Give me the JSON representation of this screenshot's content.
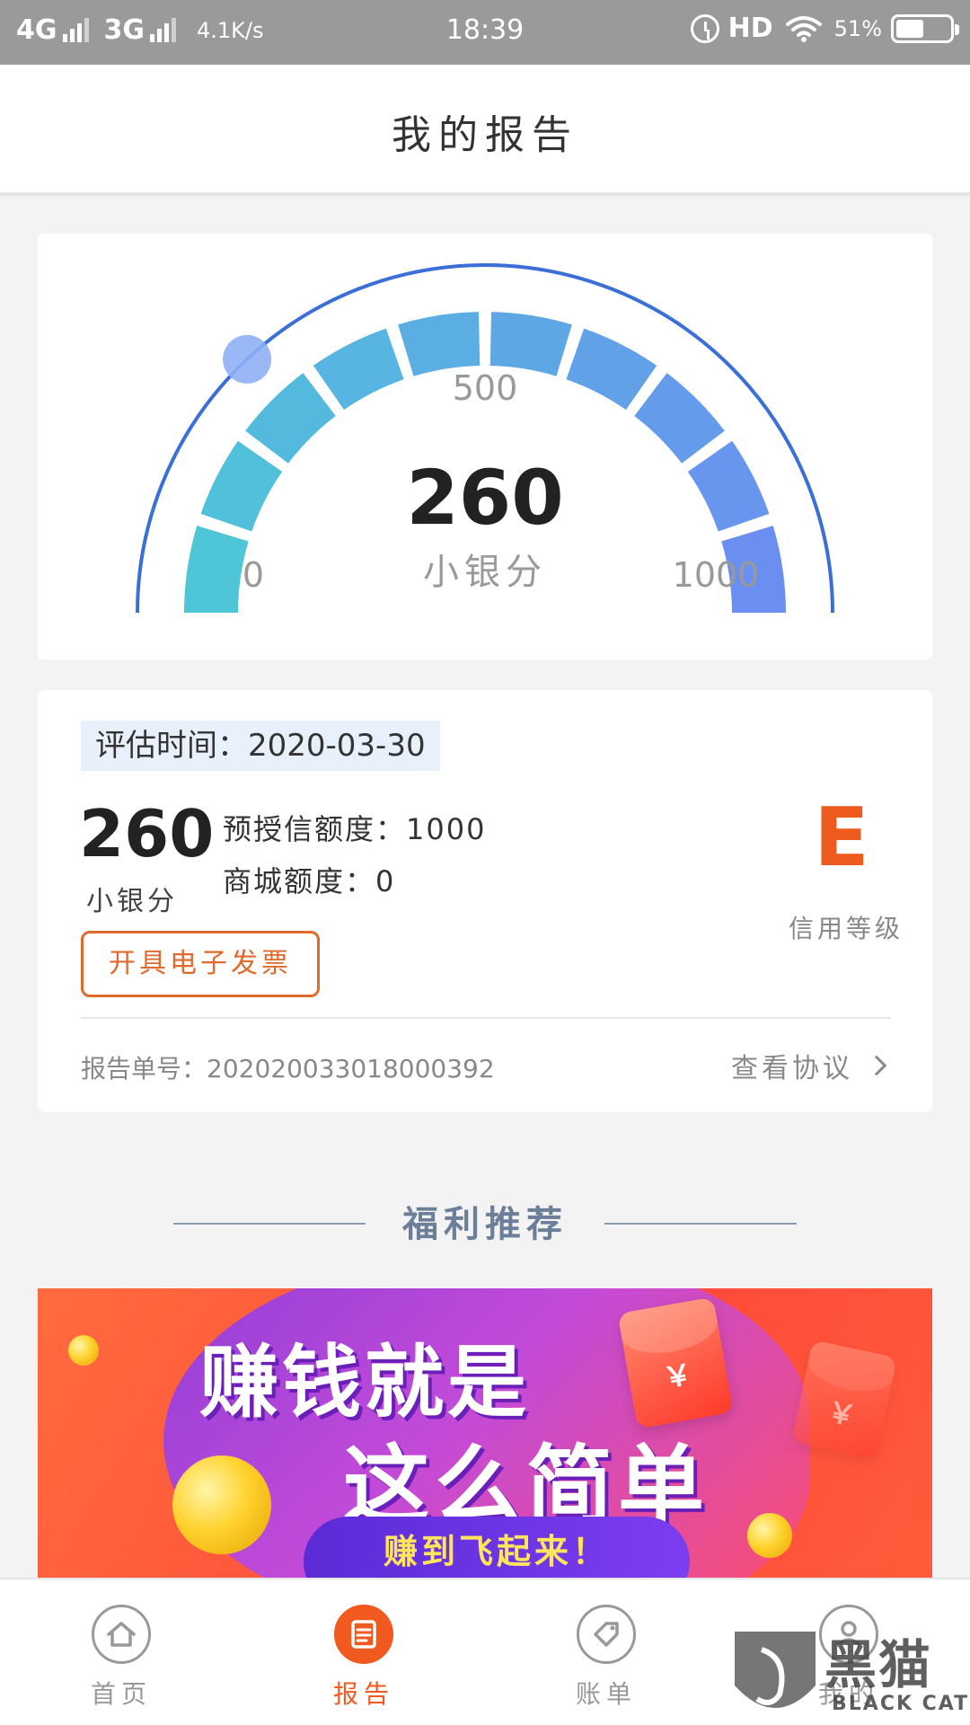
{
  "status_bar": {
    "net1": "4G",
    "net2": "3G",
    "speed": "4.1K/s",
    "time": "18:39",
    "hd": "HD",
    "battery_pct": "51%",
    "battery_level": 0.51
  },
  "header": {
    "title": "我的报告"
  },
  "gauge": {
    "score": "260",
    "score_label": "小银分",
    "scale_mid": "500",
    "scale_min": "0",
    "scale_max": "1000",
    "value": 260,
    "min": 0,
    "max": 1000,
    "colors": {
      "start": "#4ec6d8",
      "end": "#6b8ff0",
      "outer_arc": "#3a6fd8",
      "knob": "#8fb0f5"
    }
  },
  "report": {
    "eval_time": "评估时间：2020-03-30",
    "score": "260",
    "score_label": "小银分",
    "credit_line": "预授信额度：1000",
    "mall_line": "商城额度：0",
    "grade": "E",
    "grade_label": "信用等级",
    "invoice_button": "开具电子发票",
    "report_no": "报告单号：202020033018000392",
    "view_agreement": "查看协议"
  },
  "section": {
    "title": "福利推荐"
  },
  "banner": {
    "headline1": "赚钱就是",
    "headline2": "这么简单",
    "subline": "赚到飞起来！",
    "yen": "￥"
  },
  "bottom_nav": [
    {
      "label": "首页",
      "icon": "home-icon"
    },
    {
      "label": "报告",
      "icon": "report-icon"
    },
    {
      "label": "账单",
      "icon": "bill-tag-icon"
    },
    {
      "label": "我的",
      "icon": "user-icon"
    }
  ],
  "watermark": {
    "cn": "黑猫",
    "en": "BLACK CAT"
  },
  "accent_color": "#f05a1e"
}
